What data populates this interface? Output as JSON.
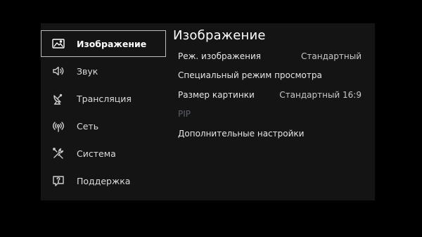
{
  "sidebar": {
    "items": [
      {
        "label": "Изображение",
        "icon": "picture-icon",
        "selected": true
      },
      {
        "label": "Звук",
        "icon": "speaker-icon",
        "selected": false
      },
      {
        "label": "Трансляция",
        "icon": "satellite-dish-icon",
        "selected": false
      },
      {
        "label": "Сеть",
        "icon": "network-icon",
        "selected": false
      },
      {
        "label": "Система",
        "icon": "tools-icon",
        "selected": false
      },
      {
        "label": "Поддержка",
        "icon": "support-icon",
        "selected": false
      }
    ]
  },
  "content": {
    "title": "Изображение",
    "rows": [
      {
        "label": "Реж. изображения",
        "value": "Стандартный",
        "enabled": true
      },
      {
        "label": "Специальный режим просмотра",
        "value": "",
        "enabled": true
      },
      {
        "label": "Размер картинки",
        "value": "Стандартный 16:9",
        "enabled": true
      },
      {
        "label": "PIP",
        "value": "",
        "enabled": false
      },
      {
        "label": "Дополнительные настройки",
        "value": "",
        "enabled": true
      }
    ]
  },
  "colors": {
    "background": "#000000",
    "panel": "#141414",
    "selection_border": "#bdbdbd",
    "disabled_text": "#5b6066"
  }
}
